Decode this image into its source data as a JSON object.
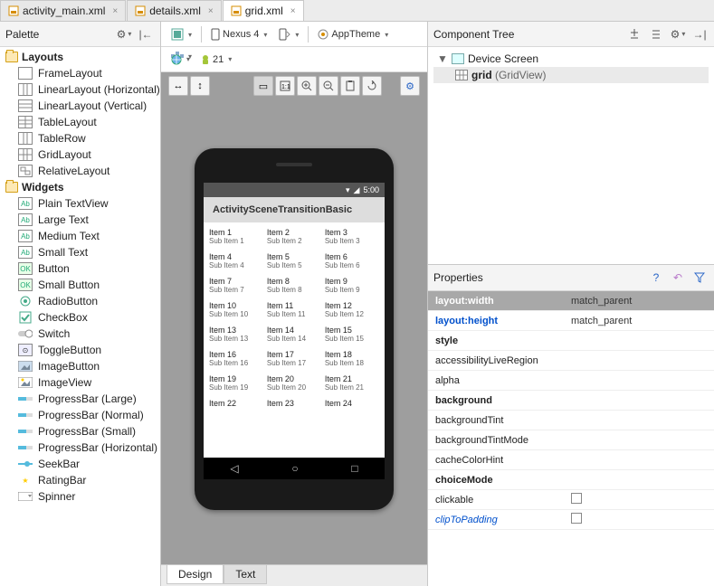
{
  "tabs": [
    {
      "label": "activity_main.xml",
      "active": false
    },
    {
      "label": "details.xml",
      "active": false
    },
    {
      "label": "grid.xml",
      "active": true
    }
  ],
  "palette": {
    "title": "Palette",
    "categories": [
      {
        "name": "Layouts",
        "items": [
          {
            "label": "FrameLayout",
            "icon": "frame"
          },
          {
            "label": "LinearLayout (Horizontal)",
            "icon": "linh"
          },
          {
            "label": "LinearLayout (Vertical)",
            "icon": "linv"
          },
          {
            "label": "TableLayout",
            "icon": "table"
          },
          {
            "label": "TableRow",
            "icon": "row"
          },
          {
            "label": "GridLayout",
            "icon": "grid"
          },
          {
            "label": "RelativeLayout",
            "icon": "rel"
          }
        ]
      },
      {
        "name": "Widgets",
        "items": [
          {
            "label": "Plain TextView",
            "icon": "ab"
          },
          {
            "label": "Large Text",
            "icon": "ab"
          },
          {
            "label": "Medium Text",
            "icon": "ab"
          },
          {
            "label": "Small Text",
            "icon": "ab"
          },
          {
            "label": "Button",
            "icon": "ok"
          },
          {
            "label": "Small Button",
            "icon": "ok"
          },
          {
            "label": "RadioButton",
            "icon": "radio"
          },
          {
            "label": "CheckBox",
            "icon": "check"
          },
          {
            "label": "Switch",
            "icon": "switch"
          },
          {
            "label": "ToggleButton",
            "icon": "toggle"
          },
          {
            "label": "ImageButton",
            "icon": "imgbtn"
          },
          {
            "label": "ImageView",
            "icon": "img"
          },
          {
            "label": "ProgressBar (Large)",
            "icon": "prog"
          },
          {
            "label": "ProgressBar (Normal)",
            "icon": "prog"
          },
          {
            "label": "ProgressBar (Small)",
            "icon": "prog"
          },
          {
            "label": "ProgressBar (Horizontal)",
            "icon": "prog"
          },
          {
            "label": "SeekBar",
            "icon": "seek"
          },
          {
            "label": "RatingBar",
            "icon": "star"
          },
          {
            "label": "Spinner",
            "icon": "spin"
          }
        ]
      }
    ]
  },
  "toolbar": {
    "device": "Nexus 4",
    "theme": "AppTheme",
    "api": "21"
  },
  "preview": {
    "status_time": "5:00",
    "app_title": "ActivitySceneTransitionBasic",
    "grid_items": [
      [
        {
          "t": "Item 1",
          "s": "Sub Item 1"
        },
        {
          "t": "Item 2",
          "s": "Sub Item 2"
        },
        {
          "t": "Item 3",
          "s": "Sub Item 3"
        }
      ],
      [
        {
          "t": "Item 4",
          "s": "Sub Item 4"
        },
        {
          "t": "Item 5",
          "s": "Sub Item 5"
        },
        {
          "t": "Item 6",
          "s": "Sub Item 6"
        }
      ],
      [
        {
          "t": "Item 7",
          "s": "Sub Item 7"
        },
        {
          "t": "Item 8",
          "s": "Sub Item 8"
        },
        {
          "t": "Item 9",
          "s": "Sub Item 9"
        }
      ],
      [
        {
          "t": "Item 10",
          "s": "Sub Item 10"
        },
        {
          "t": "Item 11",
          "s": "Sub Item 11"
        },
        {
          "t": "Item 12",
          "s": "Sub Item 12"
        }
      ],
      [
        {
          "t": "Item 13",
          "s": "Sub Item 13"
        },
        {
          "t": "Item 14",
          "s": "Sub Item 14"
        },
        {
          "t": "Item 15",
          "s": "Sub Item 15"
        }
      ],
      [
        {
          "t": "Item 16",
          "s": "Sub Item 16"
        },
        {
          "t": "Item 17",
          "s": "Sub Item 17"
        },
        {
          "t": "Item 18",
          "s": "Sub Item 18"
        }
      ],
      [
        {
          "t": "Item 19",
          "s": "Sub Item 19"
        },
        {
          "t": "Item 20",
          "s": "Sub Item 20"
        },
        {
          "t": "Item 21",
          "s": "Sub Item 21"
        }
      ],
      [
        {
          "t": "Item 22",
          "s": ""
        },
        {
          "t": "Item 23",
          "s": ""
        },
        {
          "t": "Item 24",
          "s": ""
        }
      ]
    ]
  },
  "component_tree": {
    "title": "Component Tree",
    "root": "Device Screen",
    "child_name": "grid",
    "child_type": "(GridView)"
  },
  "properties": {
    "title": "Properties",
    "rows": [
      {
        "name": "layout:width",
        "value": "match_parent",
        "sel": true,
        "bold": true
      },
      {
        "name": "layout:height",
        "value": "match_parent",
        "blue": true
      },
      {
        "name": "style",
        "value": "",
        "bold": true
      },
      {
        "name": "accessibilityLiveRegion",
        "value": ""
      },
      {
        "name": "alpha",
        "value": ""
      },
      {
        "name": "background",
        "value": "",
        "bold": true
      },
      {
        "name": "backgroundTint",
        "value": ""
      },
      {
        "name": "backgroundTintMode",
        "value": ""
      },
      {
        "name": "cacheColorHint",
        "value": ""
      },
      {
        "name": "choiceMode",
        "value": "",
        "bold": true
      },
      {
        "name": "clickable",
        "value": "checkbox"
      },
      {
        "name": "clipToPadding",
        "value": "checkbox",
        "italic": true
      }
    ]
  },
  "bottom_tabs": {
    "design": "Design",
    "text": "Text"
  }
}
